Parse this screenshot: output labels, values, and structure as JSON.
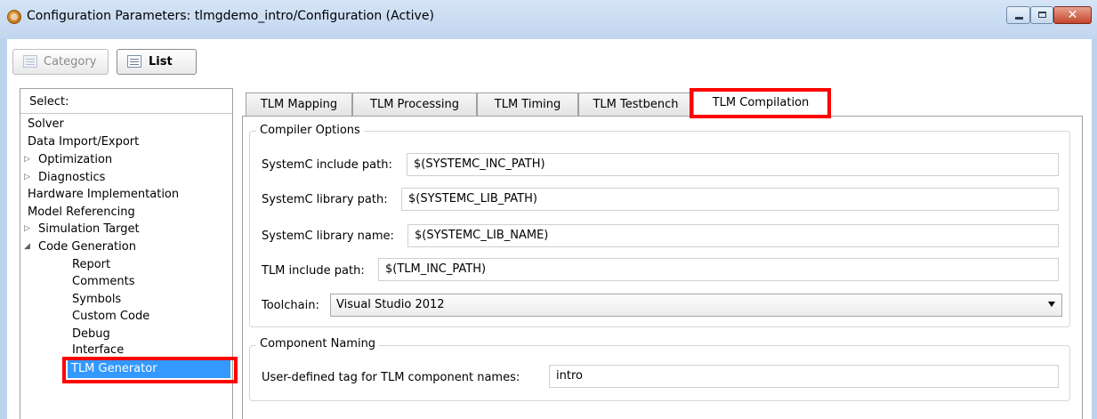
{
  "window": {
    "title": "Configuration Parameters: tlmgdemo_intro/Configuration (Active)",
    "controls": {
      "minimize": "minimize",
      "maximize": "maximize",
      "close": "✕"
    }
  },
  "toolbar": {
    "category_label": "Category",
    "list_label": "List"
  },
  "tree": {
    "header": "Select:",
    "items": [
      {
        "label": "Solver"
      },
      {
        "label": "Data Import/Export"
      },
      {
        "label": "Optimization",
        "arrow": "▷"
      },
      {
        "label": "Diagnostics",
        "arrow": "▷"
      },
      {
        "label": "Hardware Implementation"
      },
      {
        "label": "Model Referencing"
      },
      {
        "label": "Simulation Target",
        "arrow": "▷"
      },
      {
        "label": "Code Generation",
        "arrow": "◢"
      },
      {
        "label": "Report"
      },
      {
        "label": "Comments"
      },
      {
        "label": "Symbols"
      },
      {
        "label": "Custom Code"
      },
      {
        "label": "Debug"
      },
      {
        "label": "Interface"
      },
      {
        "label": "TLM Generator",
        "selected": true
      }
    ]
  },
  "tabs": [
    {
      "label": "TLM Mapping"
    },
    {
      "label": "TLM Processing"
    },
    {
      "label": "TLM Timing"
    },
    {
      "label": "TLM Testbench"
    },
    {
      "label": "TLM Compilation",
      "active": true
    }
  ],
  "compiler_options": {
    "legend": "Compiler Options",
    "systemc_include_label": "SystemC include path:",
    "systemc_include_value": "$(SYSTEMC_INC_PATH)",
    "systemc_lib_path_label": "SystemC library path:",
    "systemc_lib_path_value": "$(SYSTEMC_LIB_PATH)",
    "systemc_lib_name_label": "SystemC library name:",
    "systemc_lib_name_value": "$(SYSTEMC_LIB_NAME)",
    "tlm_include_label": "TLM include path:",
    "tlm_include_value": "$(TLM_INC_PATH)",
    "toolchain_label": "Toolchain:",
    "toolchain_value": "Visual Studio 2012"
  },
  "component_naming": {
    "legend": "Component Naming",
    "tag_label": "User-defined tag for TLM component names:",
    "tag_value": "intro"
  },
  "colors": {
    "highlight": "#ff0000",
    "selection": "#3399ff"
  }
}
